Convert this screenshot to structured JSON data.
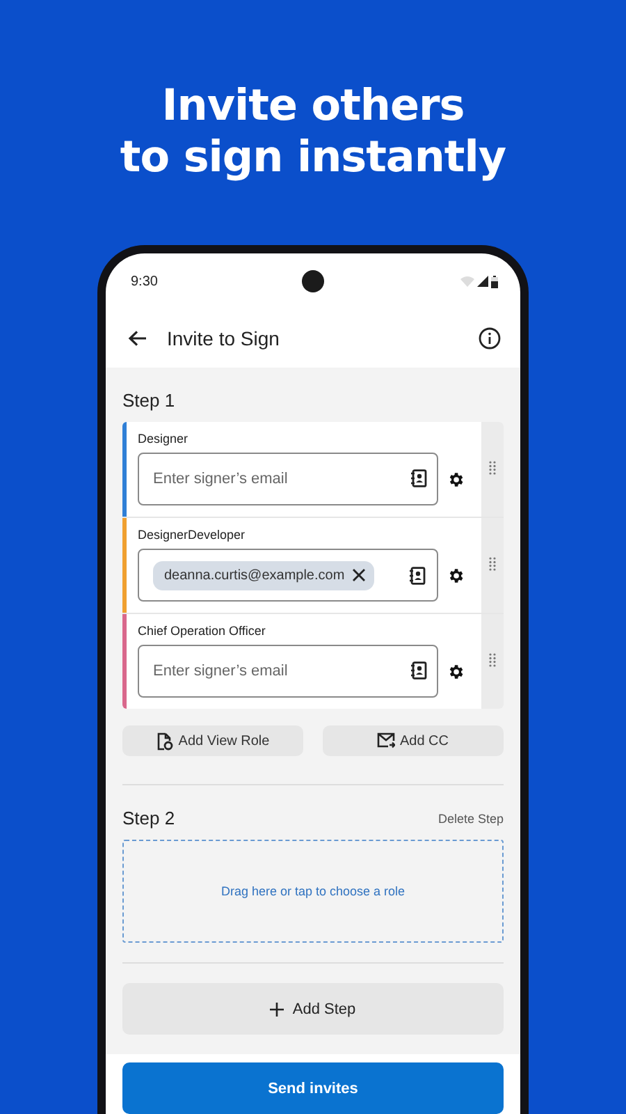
{
  "headline_lines": [
    "Invite others",
    "to sign instantly"
  ],
  "status_bar": {
    "time": "9:30"
  },
  "app_bar": {
    "title": "Invite to Sign"
  },
  "steps": [
    {
      "title": "Step 1",
      "signers": [
        {
          "role": "Designer",
          "color": "#2f7fd6",
          "placeholder": "Enter signer’s email"
        },
        {
          "role": "DesignerDeveloper",
          "color": "#f0a030",
          "email": "deanna.curtis@example.com"
        },
        {
          "role": "Chief Operation Officer",
          "color": "#d9688c",
          "placeholder": "Enter signer’s email"
        }
      ],
      "actions": [
        {
          "kind": "view-role",
          "label": "Add View Role"
        },
        {
          "kind": "cc",
          "label": "Add CC"
        }
      ]
    },
    {
      "title": "Step 2",
      "delete": "Delete Step",
      "dropzone": "Drag here or tap to choose a role"
    }
  ],
  "add_step": "Add Step",
  "send_button": "Send invites"
}
